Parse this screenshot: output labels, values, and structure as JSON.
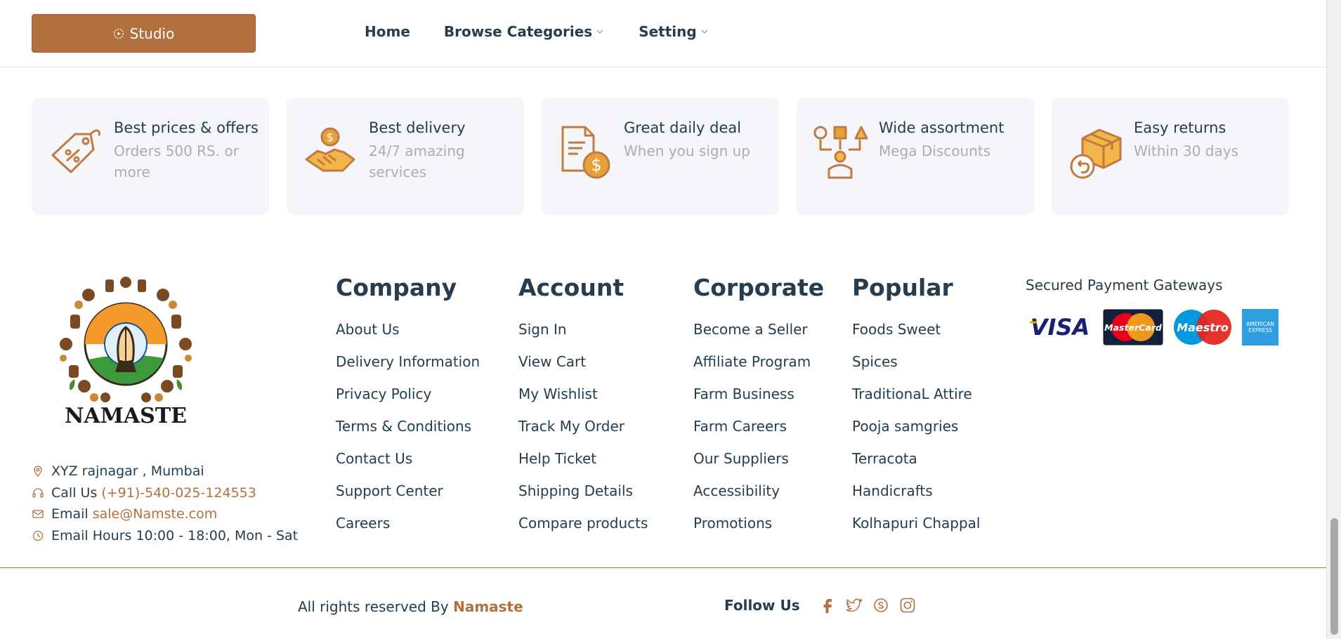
{
  "header": {
    "studio_label": "Studio",
    "nav": [
      {
        "label": "Home"
      },
      {
        "label": "Browse Categories"
      },
      {
        "label": "Setting"
      }
    ]
  },
  "features": [
    {
      "title": "Best prices & offers",
      "subtitle": "Orders 500 RS. or more",
      "icon": "price-tag-icon"
    },
    {
      "title": "Best delivery",
      "subtitle": "24/7 amazing services",
      "icon": "handshake-delivery-icon"
    },
    {
      "title": "Great daily deal",
      "subtitle": "When you sign up",
      "icon": "document-dollar-icon"
    },
    {
      "title": "Wide assortment",
      "subtitle": "Mega Discounts",
      "icon": "assortment-person-icon"
    },
    {
      "title": "Easy returns",
      "subtitle": "Within 30 days",
      "icon": "return-box-icon"
    }
  ],
  "logo_text": "NAMASTE",
  "contact": {
    "address": "XYZ rajnagar , Mumbai",
    "call_label": "Call Us",
    "phone": "(+91)-540-025-124553",
    "email_label": "Email",
    "email": "sale@Namste.com",
    "hours": "Email Hours 10:00 - 18:00, Mon - Sat"
  },
  "columns": {
    "company": {
      "title": "Company",
      "links": [
        "About Us",
        "Delivery Information",
        "Privacy Policy",
        "Terms & Conditions",
        "Contact Us",
        "Support Center",
        "Careers"
      ]
    },
    "account": {
      "title": "Account",
      "links": [
        "Sign In",
        "View Cart",
        "My Wishlist",
        "Track My Order",
        "Help Ticket",
        "Shipping Details",
        "Compare products"
      ]
    },
    "corporate": {
      "title": "Corporate",
      "links": [
        "Become a Seller",
        "Affiliate Program",
        "Farm Business",
        "Farm Careers",
        "Our Suppliers",
        "Accessibility",
        "Promotions"
      ]
    },
    "popular": {
      "title": "Popular",
      "links": [
        "Foods Sweet",
        "Spices",
        "TraditionaL Attire",
        "Pooja samgries",
        "Terracota",
        "Handicrafts",
        "Kolhapuri Chappal"
      ]
    }
  },
  "payment": {
    "title": "Secured Payment Gateways",
    "visa": "VISA",
    "mastercard": "MasterCard",
    "maestro": "Maestro",
    "amex_line1": "AMERICAN",
    "amex_line2": "EXPRESS"
  },
  "bottom": {
    "rights_prefix": "All rights reserved By",
    "brand": "Namaste",
    "follow_label": "Follow Us"
  },
  "colors": {
    "accent": "#b3703f",
    "text": "#253d4e",
    "muted": "#adadad",
    "card_bg": "#f4f6fa"
  }
}
